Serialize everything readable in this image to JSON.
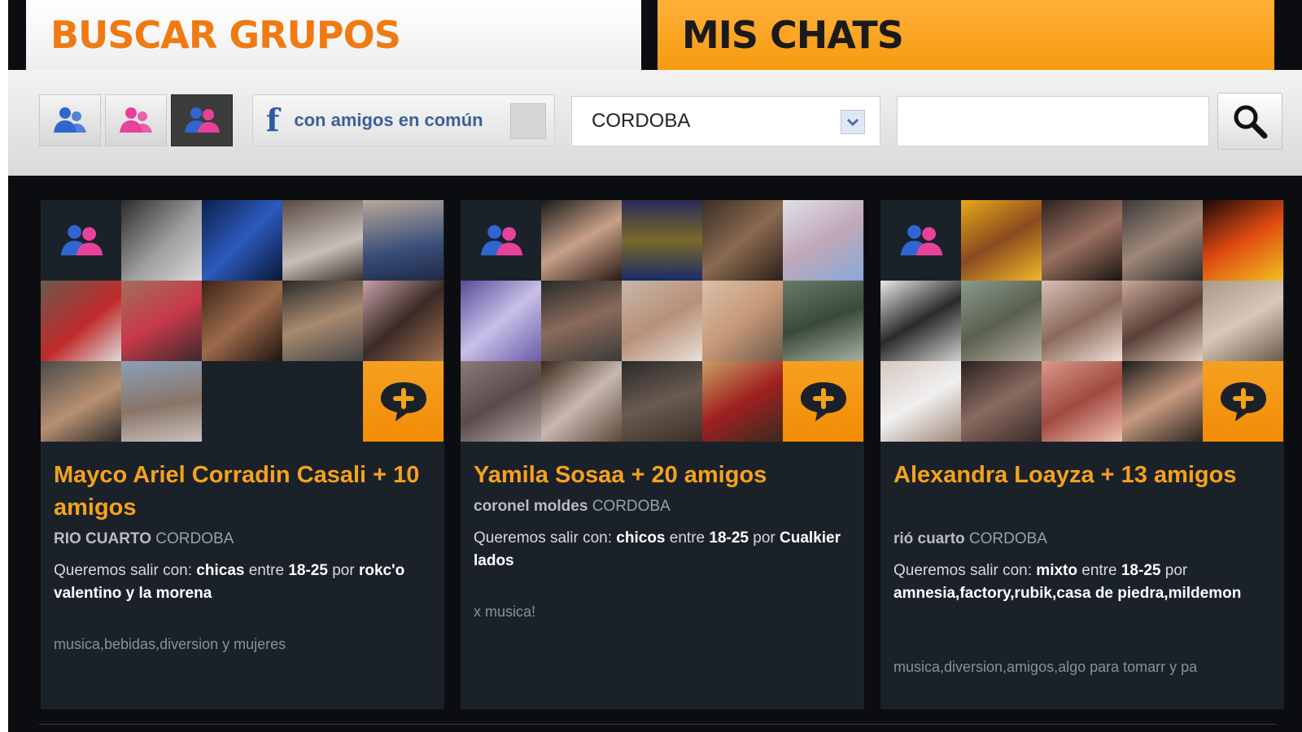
{
  "tabs": {
    "buscar": "BUSCAR GRUPOS",
    "chats": "MIS CHATS"
  },
  "filters": {
    "gender_buttons": [
      {
        "name": "male-group",
        "color": "#2f66d1"
      },
      {
        "name": "female-group",
        "color": "#e8419a"
      },
      {
        "name": "mixed-group",
        "color": "#e8419a"
      }
    ],
    "facebook_icon": "f",
    "friends_label": "con amigos en común",
    "city": "CORDOBA",
    "search_placeholder": ""
  },
  "colors": {
    "accent": "#f5a21c",
    "blue": "#2f66d1",
    "pink": "#e8419a",
    "card_bg": "#1b2129"
  },
  "groups": [
    {
      "title": "Mayco Ariel Corradin Casali + 10 amigos",
      "city_local": "RIO CUARTO",
      "province": "CORDOBA",
      "pref_prefix": "Queremos salir con:",
      "with": "chicas",
      "between": "entre",
      "ages": "18-25",
      "by": "por",
      "places": "rokc'o valentino y la morena",
      "tags": "musica,bebidas,diversion y mujeres"
    },
    {
      "title": "Yamila Sosaa + 20 amigos",
      "city_local": "coronel moldes",
      "province": "CORDOBA",
      "pref_prefix": "Queremos salir con:",
      "with": "chicos",
      "between": "entre",
      "ages": "18-25",
      "by": "por",
      "places": "Cualkier lados",
      "tags": "x musica!"
    },
    {
      "title": "Alexandra Loayza + 13 amigos",
      "city_local": "rió cuarto",
      "province": "CORDOBA",
      "pref_prefix": "Queremos salir con:",
      "with": "mixto",
      "between": "entre",
      "ages": "18-25",
      "by": "por",
      "places": "amnesia,factory,rubik,casa de piedra,mildemon",
      "tags": "musica,diversion,amigos,algo para tomarr y pa"
    }
  ]
}
